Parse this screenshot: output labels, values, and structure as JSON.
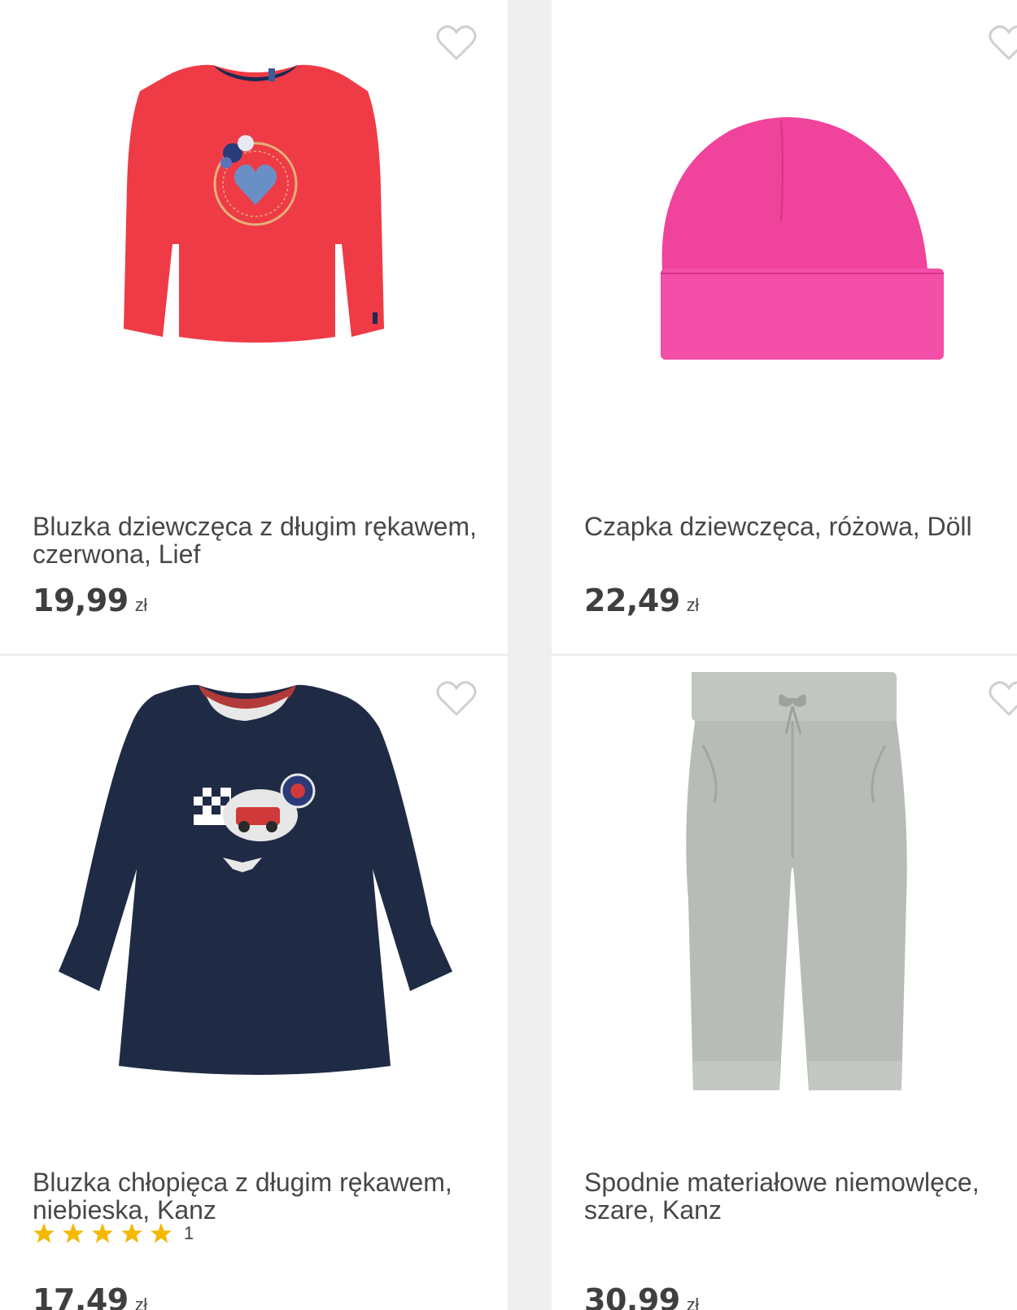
{
  "products": [
    {
      "title": "Bluzka dziewczęca z długim rękawem, czerwona, Lief",
      "price": "19,99",
      "currency": "zł",
      "image": "red-long-sleeve-shirt"
    },
    {
      "title": "Czapka dziewczęca, różowa, Döll",
      "price": "22,49",
      "currency": "zł",
      "image": "pink-beanie-hat"
    },
    {
      "title": "Bluzka chłopięca z długim rękawem, niebieska, Kanz",
      "price": "17,49",
      "currency": "zł",
      "rating": 5,
      "rating_count": "1",
      "image": "navy-long-sleeve-shirt"
    },
    {
      "title": "Spodnie materiałowe niemowlęce, szare, Kanz",
      "price": "30,99",
      "currency": "zł",
      "image": "grey-baby-trousers"
    }
  ],
  "colors": {
    "heart_outline": "#cfcfcf",
    "star": "#f5b800",
    "text": "#474747"
  }
}
